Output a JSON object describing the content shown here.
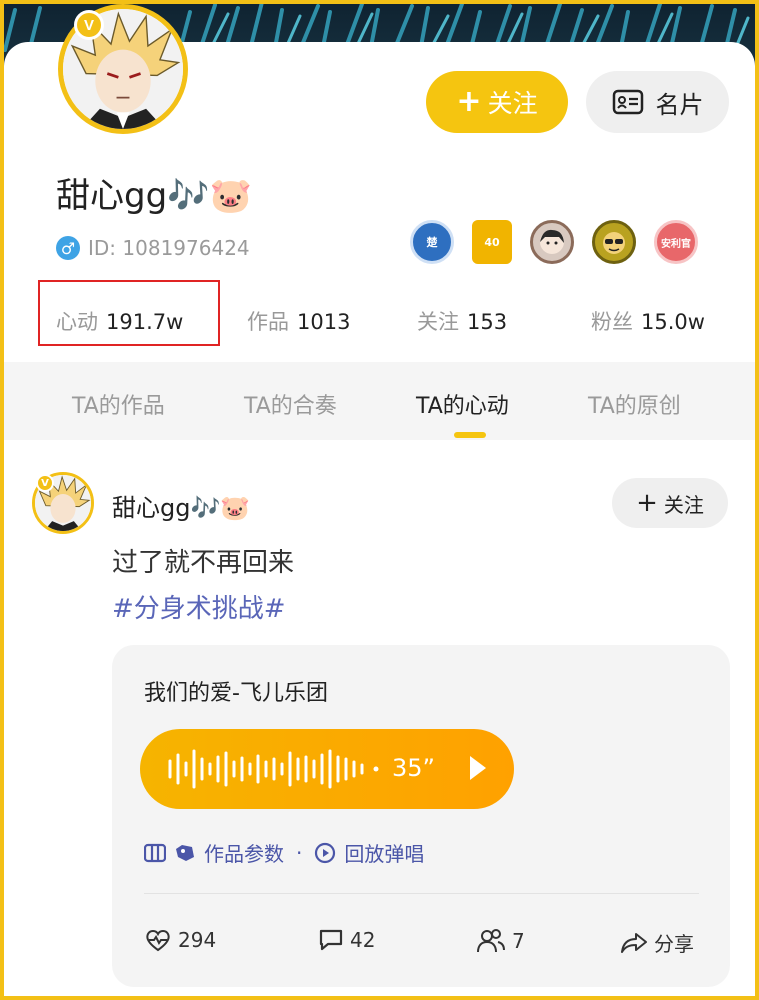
{
  "profile": {
    "username": "甜心gg🎶🐷",
    "verified_badge": "V",
    "gender_icon": "male-icon",
    "gender_symbol": "♂",
    "id_text": "ID: 1081976424",
    "follow_label": "关注",
    "card_label": "名片"
  },
  "badges": [
    {
      "name": "badge-chu",
      "text": "楚",
      "color": "#2e6fc0"
    },
    {
      "name": "badge-40",
      "text": "40",
      "color": "#f1b400"
    },
    {
      "name": "badge-girl",
      "text": "",
      "color": "#d8c9c0"
    },
    {
      "name": "badge-sunglasses",
      "text": "",
      "color": "#b9a220"
    },
    {
      "name": "badge-anquan",
      "text": "安利官",
      "color": "#e8676a"
    }
  ],
  "stats": {
    "xindong_label": "心动",
    "xindong_value": "191.7w",
    "works_label": "作品",
    "works_value": "1013",
    "following_label": "关注",
    "following_value": "153",
    "fans_label": "粉丝",
    "fans_value": "15.0w"
  },
  "tabs": [
    "TA的作品",
    "TA的合奏",
    "TA的心动",
    "TA的原创"
  ],
  "active_tab": "TA的心动",
  "post": {
    "author": "甜心gg🎶🐷",
    "follow_label": "关注",
    "text": "过了就不再回来",
    "tag": "#分身术挑战#",
    "song_title": "我们的爱-飞儿乐团",
    "duration": "35”",
    "meta_params": "作品参数",
    "meta_dot": "·",
    "meta_replay": "回放弹唱",
    "likes": "294",
    "comments": "42",
    "chorus": "7",
    "share_label": "分享"
  },
  "colors": {
    "accent": "#f5c510",
    "link": "#5a66b8",
    "highlight_box": "#e02424"
  }
}
